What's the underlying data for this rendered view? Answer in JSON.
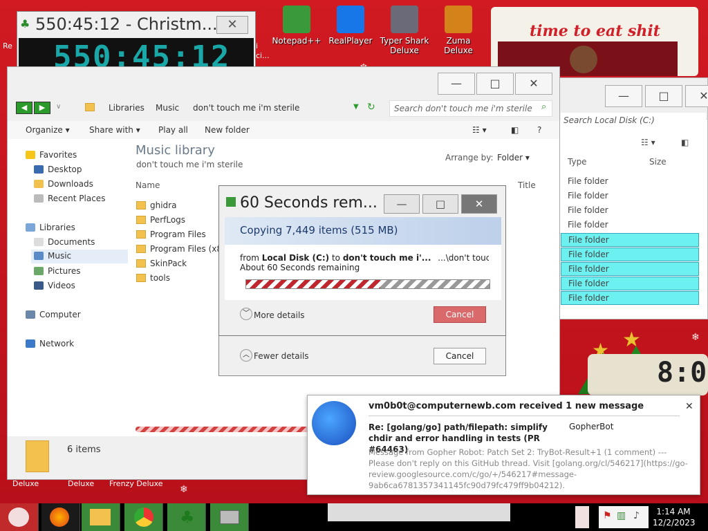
{
  "desktop": {
    "icons": [
      {
        "label": "Notepad++",
        "icon": "notepad-icon",
        "color": "#3a9a3a"
      },
      {
        "label": "RealPlayer",
        "icon": "realplayer-icon",
        "color": "#1877e8"
      },
      {
        "label": "Typer Shark Deluxe",
        "icon": "typer-shark-icon",
        "color": "#6a6a78"
      },
      {
        "label": "Zuma Deluxe",
        "icon": "zuma-icon",
        "color": "#d4821a"
      }
    ],
    "partial_labels": [
      "Re",
      "Deluxe",
      "Deluxe",
      "Frenzy Deluxe",
      "i",
      "ci..."
    ],
    "banner_text": "time to eat shit"
  },
  "clock_window": {
    "title": "550:45:12 - Christm...",
    "display": "550:45:12"
  },
  "right_window": {
    "search_placeholder": "Search Local Disk (C:)",
    "columns": [
      "Type",
      "Size"
    ],
    "rows": [
      {
        "type": "File folder",
        "selected": false
      },
      {
        "type": "File folder",
        "selected": false
      },
      {
        "type": "File folder",
        "selected": false
      },
      {
        "type": "File folder",
        "selected": false
      },
      {
        "type": "File folder",
        "selected": true
      },
      {
        "type": "File folder",
        "selected": true
      },
      {
        "type": "File folder",
        "selected": true
      },
      {
        "type": "File folder",
        "selected": true
      },
      {
        "type": "File folder",
        "selected": true
      }
    ],
    "clock_digits": "8:0"
  },
  "explorer": {
    "breadcrumb": [
      "Libraries",
      "Music",
      "don't touch me i'm sterile"
    ],
    "search_placeholder": "Search don't touch me i'm sterile",
    "toolbar": [
      "Organize",
      "Share with",
      "Play all",
      "New folder"
    ],
    "nav": {
      "favorites": "Favorites",
      "fav_items": [
        "Desktop",
        "Downloads",
        "Recent Places"
      ],
      "libraries": "Libraries",
      "lib_items": [
        "Documents",
        "Music",
        "Pictures",
        "Videos"
      ],
      "computer": "Computer",
      "network": "Network"
    },
    "library_title": "Music library",
    "library_sub": "don't touch me i'm sterile",
    "arrange_label": "Arrange by:",
    "arrange_value": "Folder",
    "columns": [
      "Name",
      "Title"
    ],
    "items": [
      "ghidra",
      "PerfLogs",
      "Program Files",
      "Program Files (x86)",
      "SkinPack",
      "tools"
    ],
    "status_count": "6 items"
  },
  "copy_dialog": {
    "title": "60 Seconds rem...",
    "heading": "Copying 7,449 items (515 MB)",
    "from_prefix": "from",
    "from_source": "Local Disk (C:)",
    "to_word": "to",
    "to_dest": "don't touch me i'...",
    "to_path": "...\\don't touch me i'm",
    "remaining": "About 60 Seconds remaining",
    "progress": 0.55,
    "more_details": "More details",
    "cancel": "Cancel",
    "fewer_details": "Fewer details"
  },
  "notification": {
    "header": "vm0b0t@computernewb.com received 1 new message",
    "subject": "Re: [golang/go] path/filepath: simplify chdir and error handling in tests (PR #64463)",
    "from": "GopherBot",
    "message": "Message from Gopher Robot: Patch Set 2: TryBot-Result+1 (1 comment) --- Please don't reply on this GitHub thread. Visit [golang.org/cl/546217](https://go-review.googlesource.com/c/go/+/546217#message-9ab6ca6781357341145fc90d79fc479ff9b04212)."
  },
  "taskbar": {
    "time": "1:14 AM",
    "date": "12/2/2023"
  }
}
